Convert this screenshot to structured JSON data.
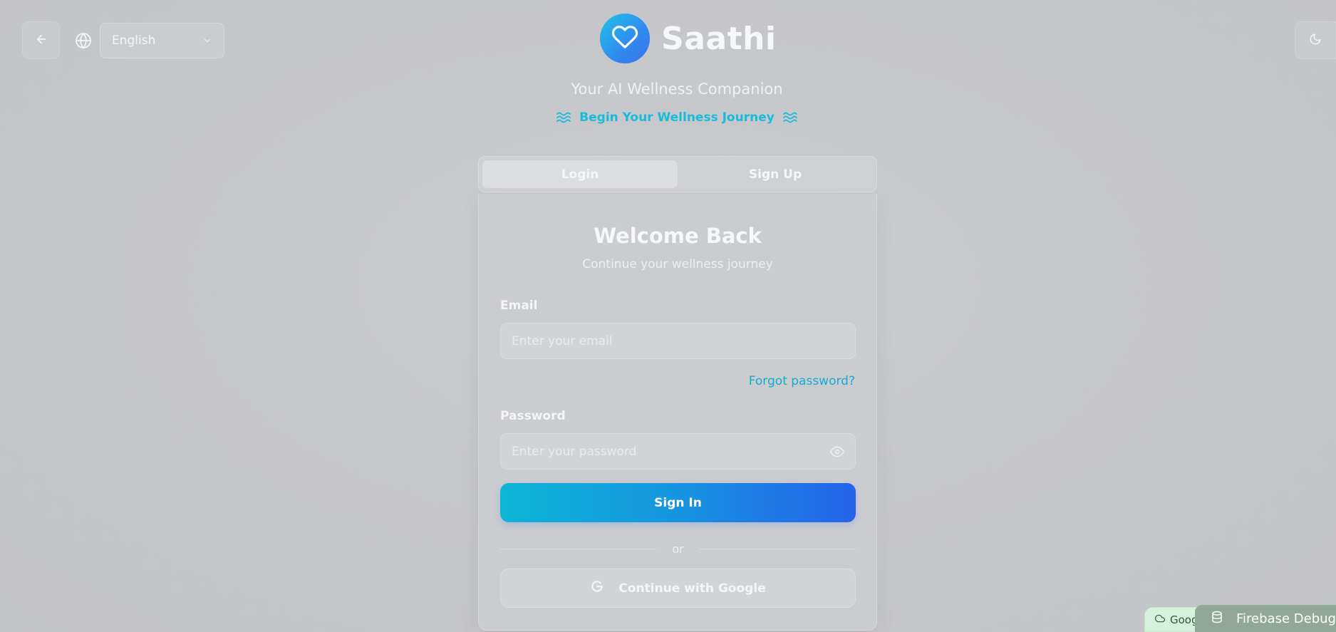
{
  "header": {
    "language": {
      "selected": "English"
    }
  },
  "brand": {
    "name": "Saathi",
    "tagline": "Your AI Wellness Companion",
    "journey": "Begin Your Wellness Journey"
  },
  "tabs": [
    {
      "label": "Login",
      "active": true
    },
    {
      "label": "Sign Up",
      "active": false
    }
  ],
  "form": {
    "title": "Welcome Back",
    "subtitle": "Continue your wellness journey",
    "email_label": "Email",
    "email_placeholder": "Enter your email",
    "forgot": "Forgot password?",
    "password_label": "Password",
    "password_placeholder": "Enter your password",
    "submit": "Sign In",
    "divider": "or",
    "google": "Continue with Google"
  },
  "debug": {
    "google_pill": "Google",
    "firebase": "Firebase Debug"
  },
  "colors": {
    "accent": "#18bcd9",
    "button_start": "#0db6d6",
    "button_end": "#2563eb"
  }
}
